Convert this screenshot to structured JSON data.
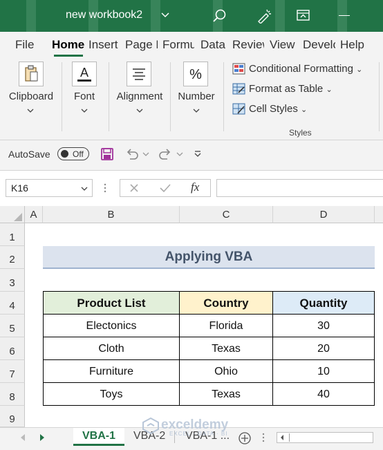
{
  "titlebar": {
    "title": "new workbook2"
  },
  "tabs": [
    {
      "label": "File"
    },
    {
      "label": "Home"
    },
    {
      "label": "Insert"
    },
    {
      "label": "Page L"
    },
    {
      "label": "Formu"
    },
    {
      "label": "Data"
    },
    {
      "label": "Review"
    },
    {
      "label": "View"
    },
    {
      "label": "Develo"
    },
    {
      "label": "Help"
    }
  ],
  "ribbon": {
    "clipboard": "Clipboard",
    "font": "Font",
    "alignment": "Alignment",
    "number": "Number",
    "conditional_formatting": "Conditional Formatting",
    "format_as_table": "Format as Table",
    "cell_styles": "Cell Styles",
    "styles_group": "Styles"
  },
  "qat": {
    "autosave": "AutoSave",
    "toggle_state": "Off"
  },
  "formula_bar": {
    "name_box": "K16",
    "fx": "fx",
    "formula": ""
  },
  "grid": {
    "columns": [
      "A",
      "B",
      "C",
      "D"
    ],
    "rows": [
      "1",
      "2",
      "3",
      "4",
      "5",
      "6",
      "7",
      "8",
      "9"
    ],
    "title": "Applying VBA",
    "headers": [
      "Product List",
      "Country",
      "Quantity"
    ],
    "data": [
      [
        "Electonics",
        "Florida",
        "30"
      ],
      [
        "Cloth",
        "Texas",
        "20"
      ],
      [
        "Furniture",
        "Ohio",
        "10"
      ],
      [
        "Toys",
        "Texas",
        "40"
      ]
    ]
  },
  "sheets": [
    {
      "label": "VBA-1",
      "active": true
    },
    {
      "label": "VBA-2",
      "active": false
    },
    {
      "label": "VBA-1 ...",
      "active": false
    }
  ],
  "watermark": {
    "brand": "exceldemy",
    "tagline": "EXCEL · DATA · BI"
  },
  "colors": {
    "excel_green": "#217346",
    "title_fill": "#dce3ee",
    "product_header_fill": "#e2efda",
    "country_header_fill": "#fff2cc",
    "quantity_header_fill": "#ddebf7"
  }
}
